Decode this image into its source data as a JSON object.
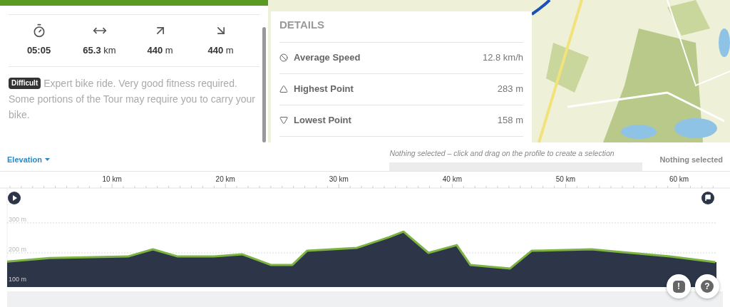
{
  "stats": [
    {
      "kind": "duration",
      "value": "05:05"
    },
    {
      "kind": "distance",
      "value": "65.3",
      "unit": "km"
    },
    {
      "kind": "uphill",
      "value": "440",
      "unit": "m"
    },
    {
      "kind": "downhill",
      "value": "440",
      "unit": "m"
    }
  ],
  "description": {
    "badge": "Difficult",
    "text": "Expert bike ride. Very good fitness required. Some portions of the Tour may require you to carry your bike."
  },
  "details": {
    "title": "DETAILS",
    "rows": [
      {
        "kind": "speed",
        "label": "Average Speed",
        "value": "12.8 km/h"
      },
      {
        "kind": "highest",
        "label": "Highest Point",
        "value": "283 m"
      },
      {
        "kind": "lowest",
        "label": "Lowest Point",
        "value": "158 m"
      }
    ]
  },
  "profile": {
    "hint": "Nothing selected – click and drag on the profile to create a selection",
    "selection": "Nothing selected",
    "chart_data": {
      "type": "area",
      "x": [
        0.75,
        4.5,
        11.4,
        13.6,
        15.8,
        19,
        21.5,
        24,
        25.9,
        27.2,
        31.6,
        34.4,
        35.7,
        37.9,
        40.4,
        41.6,
        45.1,
        47,
        52.3,
        53.6,
        59.2,
        63.2
      ],
      "series": [
        {
          "name": "Elevation",
          "color": "#7cb342",
          "values": [
            171,
            183,
            188,
            212,
            188,
            188,
            195,
            160,
            160,
            207,
            217,
            252,
            271,
            200,
            226,
            160,
            148,
            207,
            212,
            207,
            188,
            169
          ]
        }
      ],
      "xlim": [
        0.75,
        63.3
      ],
      "ylim": [
        86,
        414
      ],
      "grid": true,
      "xticks": [
        {
          "value": 10,
          "label": "10 km"
        },
        {
          "value": 20,
          "label": "20 km"
        },
        {
          "value": 30,
          "label": "30 km"
        },
        {
          "value": 40,
          "label": "40 km"
        },
        {
          "value": 50,
          "label": "50 km"
        },
        {
          "value": 60,
          "label": "60 km"
        }
      ],
      "yticks": [
        {
          "value": 100,
          "label": "100 m"
        },
        {
          "value": 200,
          "label": "200 m"
        },
        {
          "value": 300,
          "label": "300 m"
        }
      ]
    }
  },
  "buttons": [
    {
      "kind": "report",
      "label": "!"
    },
    {
      "kind": "help",
      "label": "?"
    }
  ]
}
